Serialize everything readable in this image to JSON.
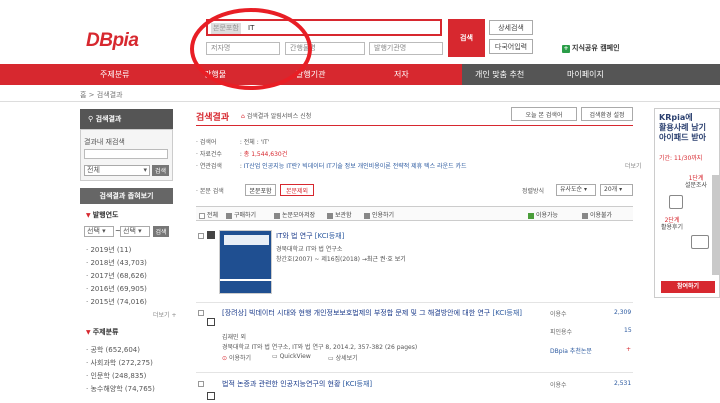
{
  "header": {
    "logo": "DBpia",
    "search_scope_label": "본문포함",
    "search_value": "IT",
    "search_button": "검색",
    "sub_fields": [
      "저자명",
      "간행물명",
      "발행기관명"
    ],
    "advanced_search": "상세검색",
    "multilang_search": "다국어입력",
    "knowledge_share": "지식공유 캠페인"
  },
  "nav": {
    "items": [
      "주제분류",
      "간행물",
      "발행기관",
      "저자",
      "개인 맞춤 추천",
      "마이페이지"
    ]
  },
  "breadcrumb": "홈 > 검색결과",
  "sidebar": {
    "search_results_title": "검색결과",
    "refine_label": "결과내 재검색",
    "scope_select": "전체",
    "scope_button": "검색",
    "narrow_title": "검색결과 좁혀보기",
    "year_section": "발행연도",
    "year_from": "선택",
    "year_to": "선택",
    "year_button": "검색",
    "years": [
      "2019년 (11)",
      "2018년 (43,703)",
      "2017년 (68,626)",
      "2016년 (69,905)",
      "2015년 (74,016)"
    ],
    "more": "더보기 +",
    "subject_section": "주제분류",
    "subjects": [
      "공학 (652,604)",
      "사회과학 (272,275)",
      "인문학 (248,835)",
      "농수해양학 (74,765)"
    ]
  },
  "main": {
    "title": "검색결과",
    "alert_label": "검색결과 알림서비스 신청",
    "today_button": "오늘 본 검색어",
    "settings_button": "검색환경 설정",
    "query_label": "검색어",
    "query_value": "전체 : 'IT'",
    "count_label": "자료건수",
    "count_value": "총 1,544,630건",
    "related_label": "연관검색",
    "related_terms": [
      "IT산업",
      "인공지능",
      "IT란?",
      "빅데이터",
      "IT기술",
      "정보",
      "개인비용이론",
      "전략적 제휴",
      "텍스 라운드 카드"
    ],
    "related_more": "더보기",
    "body_label": "본문 검색",
    "body_include": "본문포함",
    "body_exclude": "본문제외",
    "sort_label": "정렬방식",
    "sort_value": "유사도순",
    "per_page": "20개",
    "toolbar": {
      "all": "전체",
      "cart": "구매하기",
      "export": "논문모아저장",
      "bookmark": "보관함",
      "cite": "인용하기",
      "available": "이용가능",
      "instant": "이용불가"
    },
    "results": [
      {
        "title": "IT와 법 연구",
        "badge": "[KCI등재]",
        "meta1": "경북대학교 IT와 법 연구소",
        "meta2": "창간호(2007) ~ 제16집(2018)",
        "latest": "→최근 권·호 보기"
      },
      {
        "prefix": "[장려상]",
        "title": "빅데이터 시대와 현행 개인정보보호법제의 부정합 문제 및 그 해결방안에 대한 연구",
        "badge": "[KCI등재]",
        "author": "김재민 외",
        "meta": "경북대학교 IT와 법 연구소, IT와 법 연구 8, 2014.2, 357-382 (26 pages)",
        "actions": [
          "이용하기",
          "QuickView",
          "상세보기"
        ],
        "stat_labels": [
          "이용수",
          "피인용수",
          "DBpia 추천논문"
        ],
        "stat_values": [
          "2,309",
          "15",
          "+"
        ]
      },
      {
        "title": "법적 논증과 관련한 인공지능연구의 현황",
        "badge": "[KCI등재]",
        "stat_label": "이용수",
        "stat_value": "2,531"
      }
    ]
  },
  "banner": {
    "line1": "KRpia에",
    "line2": "활용사례 남기",
    "line3": "아이패드 받아",
    "date": "기간: 11/30까지",
    "step1_num": "1단계",
    "step1": "설문조사",
    "step2_num": "2단계",
    "step2": "활용후기",
    "join": "참여하기"
  }
}
